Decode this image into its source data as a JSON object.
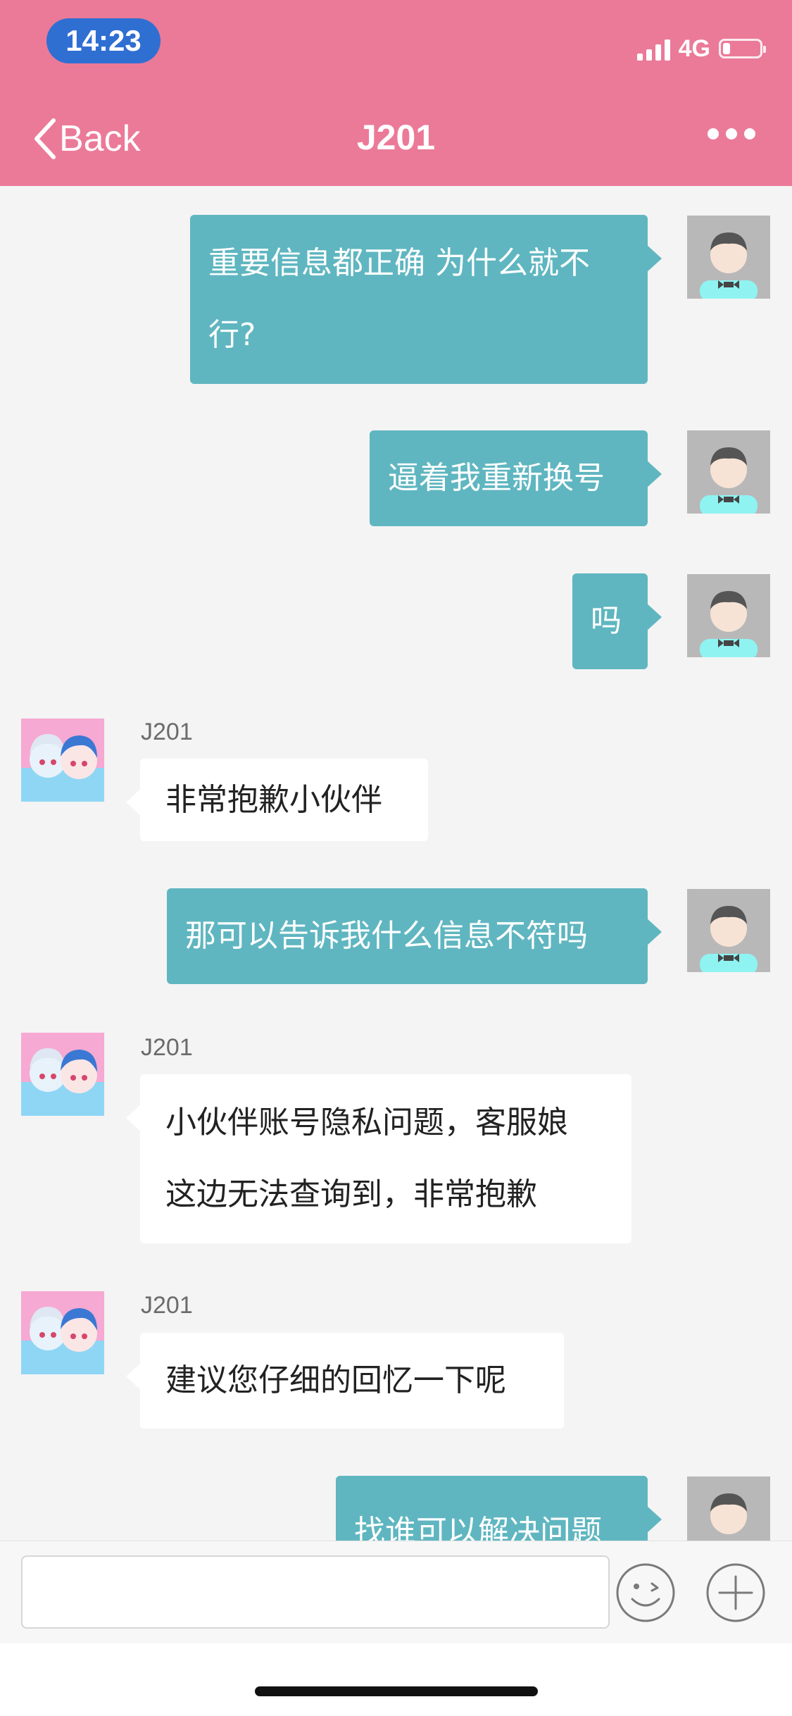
{
  "status_bar": {
    "time": "14:23",
    "network": "4G"
  },
  "nav": {
    "back_label": "Back",
    "title": "J201"
  },
  "messages": [
    {
      "side": "out",
      "lines": [
        "重要信息都正确 为什么就不",
        "行?"
      ]
    },
    {
      "side": "out",
      "lines": [
        "逼着我重新换号"
      ]
    },
    {
      "side": "out",
      "lines": [
        "吗"
      ]
    },
    {
      "side": "in",
      "sender": "J201",
      "lines": [
        "非常抱歉小伙伴"
      ]
    },
    {
      "side": "out",
      "lines": [
        "那可以告诉我什么信息不符吗"
      ]
    },
    {
      "side": "in",
      "sender": "J201",
      "lines": [
        "小伙伴账号隐私问题，客服娘",
        "这边无法查询到，非常抱歉"
      ]
    },
    {
      "side": "in",
      "sender": "J201",
      "lines": [
        "建议您仔细的回忆一下呢"
      ]
    },
    {
      "side": "out",
      "lines": [
        "找谁可以解决问题"
      ]
    }
  ],
  "input": {
    "value": "",
    "placeholder": ""
  },
  "colors": {
    "header": "#eb7a98",
    "outgoing_bubble": "#5fb6c0",
    "incoming_bubble": "#ffffff",
    "background": "#f4f4f4"
  },
  "icons": [
    "back-chevron-icon",
    "more-dots-icon",
    "user-avatar-icon",
    "agent-avatar-icon",
    "emoji-icon",
    "add-icon",
    "signal-icon",
    "battery-icon"
  ]
}
